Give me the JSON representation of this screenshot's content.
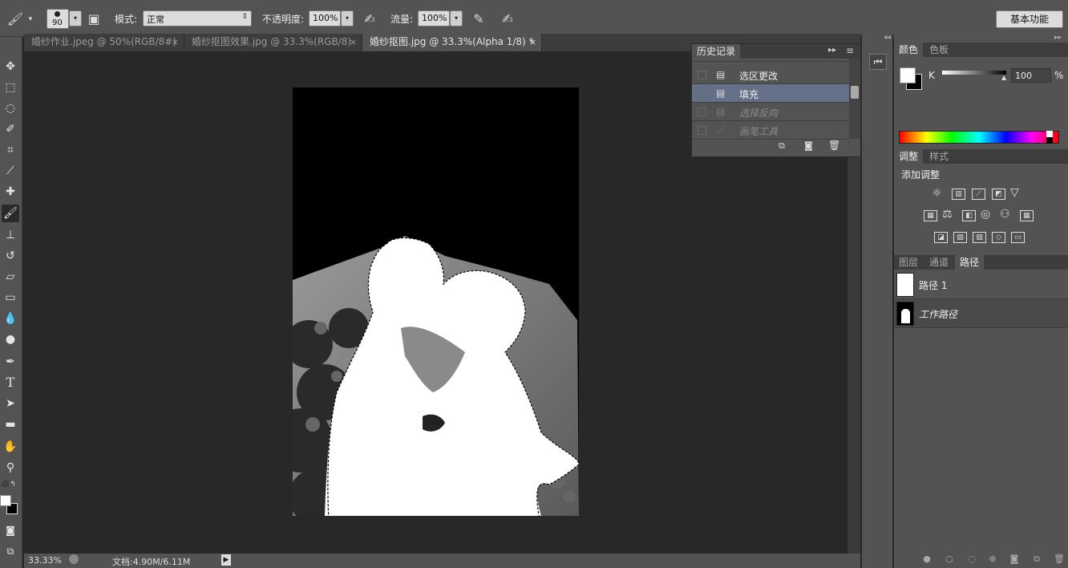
{
  "options_bar": {
    "brush_size": "90",
    "mode_label": "模式:",
    "mode_value": "正常",
    "opacity_label": "不透明度:",
    "opacity_value": "100%",
    "flow_label": "流量:",
    "flow_value": "100%",
    "workspace": "基本功能"
  },
  "tabs": [
    {
      "label": "婚纱作业.jpeg @ 50%(RGB/8#)",
      "close": "×"
    },
    {
      "label": "婚纱抠图效果.jpg @ 33.3%(RGB/8)",
      "close": "×"
    },
    {
      "label": "婚纱抠图.jpg @ 33.3%(Alpha 1/8) *",
      "close": "×"
    }
  ],
  "history": {
    "title": "历史记录",
    "items": [
      {
        "label": "选区更改"
      },
      {
        "label": "填充"
      },
      {
        "label": "选择反向"
      },
      {
        "label": "画笔工具"
      }
    ]
  },
  "color_panel": {
    "tabs": [
      "颜色",
      "色板"
    ],
    "channel": "K",
    "value": "100",
    "unit": "%"
  },
  "adjust_panel": {
    "tabs": [
      "调整",
      "样式"
    ],
    "title": "添加调整"
  },
  "layers_panel": {
    "tabs": [
      "图层",
      "通道",
      "路径"
    ],
    "paths": [
      {
        "label": "路径 1"
      },
      {
        "label": "工作路径"
      }
    ]
  },
  "status": {
    "zoom": "33.33%",
    "doc": "文档:4.90M/6.11M"
  },
  "colors": {
    "ui_bg": "#535353",
    "canvas_bg": "#282828",
    "selected_history": "#637087"
  }
}
